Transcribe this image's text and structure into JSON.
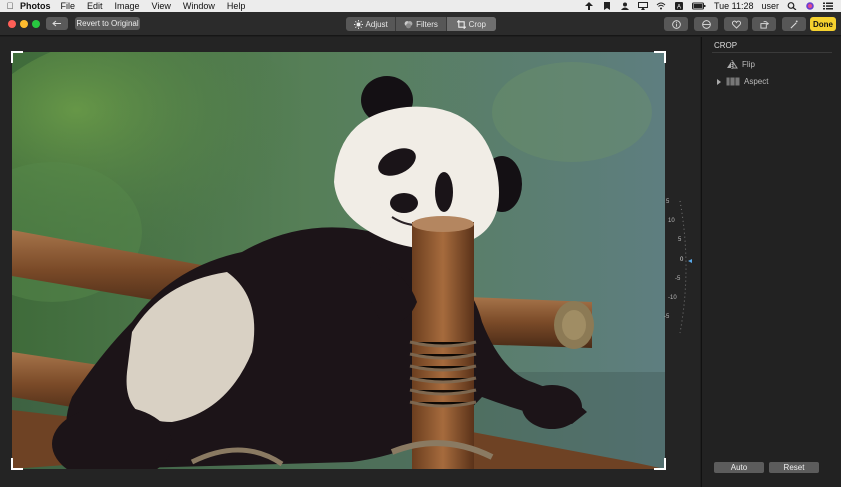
{
  "menubar": {
    "app_name": "Photos",
    "items": [
      "File",
      "Edit",
      "Image",
      "View",
      "Window",
      "Help"
    ],
    "clock": "Tue 11:28",
    "user": "user"
  },
  "toolbar": {
    "revert_label": "Revert to Original",
    "tabs": [
      {
        "label": "Adjust",
        "icon": "sun-icon"
      },
      {
        "label": "Filters",
        "icon": "filter-circles-icon"
      },
      {
        "label": "Crop",
        "icon": "crop-icon",
        "active": true
      }
    ],
    "done_label": "Done"
  },
  "dial": {
    "ticks": [
      "5",
      "10",
      "5",
      "0",
      "-5",
      "-10",
      "-5"
    ]
  },
  "panel": {
    "header": "CROP",
    "items": [
      {
        "label": "Flip",
        "icon": "flip-icon"
      },
      {
        "label": "Aspect",
        "icon": "aspect-icon"
      }
    ],
    "auto_label": "Auto",
    "reset_label": "Reset"
  },
  "colors": {
    "done_accent": "#f5d12e",
    "toolbar_bg": "#2b2b2b",
    "canvas_bg": "#242424"
  }
}
